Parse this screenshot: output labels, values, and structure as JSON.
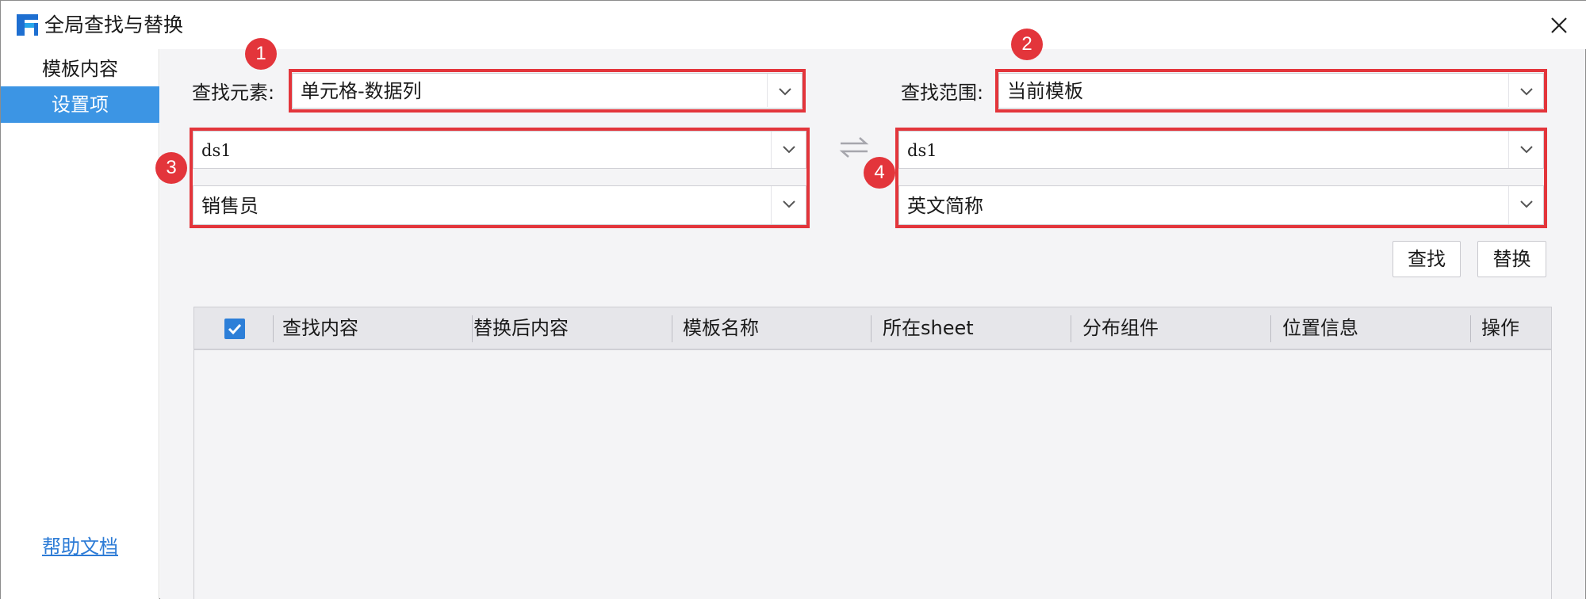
{
  "window": {
    "title": "全局查找与替换"
  },
  "sidebar": {
    "items": [
      {
        "label": "模板内容"
      },
      {
        "label": "设置项",
        "active": true
      }
    ],
    "help_link": "帮助文档"
  },
  "search": {
    "element_label": "查找元素:",
    "element_value": "单元格-数据列",
    "scope_label": "查找范围:",
    "scope_value": "当前模板",
    "source_dataset": "ds1",
    "source_column": "销售员",
    "target_dataset": "ds1",
    "target_column": "英文简称"
  },
  "badges": [
    "1",
    "2",
    "3",
    "4"
  ],
  "buttons": {
    "find": "查找",
    "replace": "替换"
  },
  "table": {
    "columns": [
      "查找内容",
      "替换后内容",
      "模板名称",
      "所在sheet",
      "分布组件",
      "位置信息",
      "操作"
    ],
    "select_all_checked": true,
    "rows": []
  },
  "colors": {
    "accent": "#3c95e4",
    "highlight_red": "#e3353b",
    "link": "#2c7bd6"
  },
  "icons": {
    "app": "app-logo-icon",
    "close": "close-icon",
    "swap": "swap-arrows-icon",
    "dropdown": "chevron-down-icon",
    "checkbox": "checkbox-checked-icon"
  }
}
